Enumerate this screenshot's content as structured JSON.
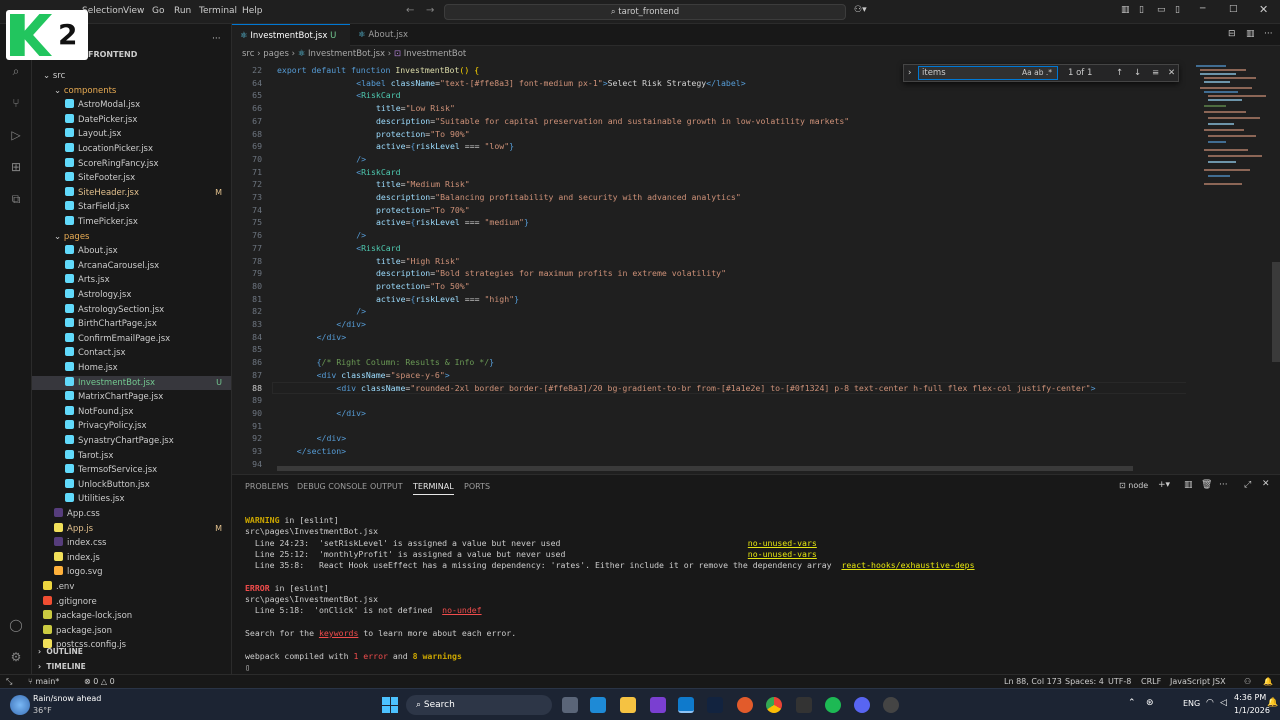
{
  "menu": [
    "Selection",
    "View",
    "Go",
    "Run",
    "Terminal",
    "Help"
  ],
  "logo_text": "2",
  "command_center": "tarot_frontend",
  "explorer": {
    "root": "FRONTEND",
    "rows": [
      {
        "label": "src",
        "indent": 1,
        "type": "folder"
      },
      {
        "label": "components",
        "indent": 2,
        "type": "folder",
        "color": "#e8ab53"
      },
      {
        "label": "AstroModal.jsx",
        "indent": 3,
        "type": "jsx"
      },
      {
        "label": "DatePicker.jsx",
        "indent": 3,
        "type": "jsx"
      },
      {
        "label": "Layout.jsx",
        "indent": 3,
        "type": "jsx"
      },
      {
        "label": "LocationPicker.jsx",
        "indent": 3,
        "type": "jsx"
      },
      {
        "label": "ScoreRingFancy.jsx",
        "indent": 3,
        "type": "jsx"
      },
      {
        "label": "SiteFooter.jsx",
        "indent": 3,
        "type": "jsx"
      },
      {
        "label": "SiteHeader.jsx",
        "indent": 3,
        "type": "jsx",
        "badge": "M",
        "color": "#e2c08d"
      },
      {
        "label": "StarField.jsx",
        "indent": 3,
        "type": "jsx"
      },
      {
        "label": "TimePicker.jsx",
        "indent": 3,
        "type": "jsx"
      },
      {
        "label": "pages",
        "indent": 2,
        "type": "folder",
        "color": "#e8ab53"
      },
      {
        "label": "About.jsx",
        "indent": 3,
        "type": "jsx"
      },
      {
        "label": "ArcanaCarousel.jsx",
        "indent": 3,
        "type": "jsx"
      },
      {
        "label": "Arts.jsx",
        "indent": 3,
        "type": "jsx"
      },
      {
        "label": "Astrology.jsx",
        "indent": 3,
        "type": "jsx"
      },
      {
        "label": "AstrologySection.jsx",
        "indent": 3,
        "type": "jsx"
      },
      {
        "label": "BirthChartPage.jsx",
        "indent": 3,
        "type": "jsx"
      },
      {
        "label": "ConfirmEmailPage.jsx",
        "indent": 3,
        "type": "jsx"
      },
      {
        "label": "Contact.jsx",
        "indent": 3,
        "type": "jsx"
      },
      {
        "label": "Home.jsx",
        "indent": 3,
        "type": "jsx"
      },
      {
        "label": "InvestmentBot.jsx",
        "indent": 3,
        "type": "jsx",
        "badge": "U",
        "color": "#73c991",
        "selected": true
      },
      {
        "label": "MatrixChartPage.jsx",
        "indent": 3,
        "type": "jsx"
      },
      {
        "label": "NotFound.jsx",
        "indent": 3,
        "type": "jsx"
      },
      {
        "label": "PrivacyPolicy.jsx",
        "indent": 3,
        "type": "jsx"
      },
      {
        "label": "SynastryChartPage.jsx",
        "indent": 3,
        "type": "jsx"
      },
      {
        "label": "Tarot.jsx",
        "indent": 3,
        "type": "jsx"
      },
      {
        "label": "TermsofService.jsx",
        "indent": 3,
        "type": "jsx"
      },
      {
        "label": "UnlockButton.jsx",
        "indent": 3,
        "type": "jsx"
      },
      {
        "label": "Utilities.jsx",
        "indent": 3,
        "type": "jsx"
      },
      {
        "label": "App.css",
        "indent": 2,
        "type": "css"
      },
      {
        "label": "App.js",
        "indent": 2,
        "type": "js",
        "badge": "M",
        "color": "#e2c08d"
      },
      {
        "label": "index.css",
        "indent": 2,
        "type": "css"
      },
      {
        "label": "index.js",
        "indent": 2,
        "type": "js"
      },
      {
        "label": "logo.svg",
        "indent": 2,
        "type": "svg"
      },
      {
        "label": ".env",
        "indent": 1,
        "type": "env"
      },
      {
        "label": ".gitignore",
        "indent": 1,
        "type": "git"
      },
      {
        "label": "package-lock.json",
        "indent": 1,
        "type": "json"
      },
      {
        "label": "package.json",
        "indent": 1,
        "type": "json"
      },
      {
        "label": "postcss.config.js",
        "indent": 1,
        "type": "js"
      }
    ],
    "outline": "OUTLINE",
    "timeline": "TIMELINE"
  },
  "tabs": [
    {
      "label": "InvestmentBot.jsx",
      "suffix": "U",
      "active": true
    },
    {
      "label": "About.jsx",
      "suffix": "",
      "active": false
    }
  ],
  "breadcrumb": [
    "src",
    "pages",
    "InvestmentBot.jsx",
    "InvestmentBot"
  ],
  "find": {
    "value": "items",
    "result": "1 of 1",
    "opts": "Aa ab .*"
  },
  "code": [
    {
      "n": "22",
      "t": "<span class='kw'>export default function</span> <span class='fn'>InvestmentBot</span><span class='br'>()</span> <span class='br'>{</span>",
      "indent": 0
    },
    {
      "n": "64",
      "t": "<span class='tg'>&lt;label</span> <span class='at'>className</span><span class='pl'>=</span><span class='st'>\"text-[#ffe8a3] font-medium px-1\"</span><span class='tg'>&gt;</span><span class='pl'>Select Risk Strategy</span><span class='tg'>&lt;/label&gt;</span>",
      "indent": 12
    },
    {
      "n": "65",
      "t": "<span class='tg'>&lt;</span><span class='cp'>RiskCard</span>",
      "indent": 12
    },
    {
      "n": "66",
      "t": "<span class='at'>title</span><span class='pl'>=</span><span class='st'>\"Low Risk\"</span>",
      "indent": 15
    },
    {
      "n": "67",
      "t": "<span class='at'>description</span><span class='pl'>=</span><span class='st'>\"Suitable for capital preservation and sustainable growth in low-volatility markets\"</span>",
      "indent": 15
    },
    {
      "n": "68",
      "t": "<span class='at'>protection</span><span class='pl'>=</span><span class='st'>\"To 90%\"</span>",
      "indent": 15
    },
    {
      "n": "69",
      "t": "<span class='at'>active</span><span class='pl'>=</span><span class='kw'>{</span><span class='at'>riskLevel</span> <span class='pl'>===</span> <span class='st'>\"low\"</span><span class='kw'>}</span>",
      "indent": 15
    },
    {
      "n": "70",
      "t": "<span class='tg'>/&gt;</span>",
      "indent": 12
    },
    {
      "n": "71",
      "t": "<span class='tg'>&lt;</span><span class='cp'>RiskCard</span>",
      "indent": 12
    },
    {
      "n": "72",
      "t": "<span class='at'>title</span><span class='pl'>=</span><span class='st'>\"Medium Risk\"</span>",
      "indent": 15
    },
    {
      "n": "73",
      "t": "<span class='at'>description</span><span class='pl'>=</span><span class='st'>\"Balancing profitability and security with advanced analytics\"</span>",
      "indent": 15
    },
    {
      "n": "74",
      "t": "<span class='at'>protection</span><span class='pl'>=</span><span class='st'>\"To 70%\"</span>",
      "indent": 15
    },
    {
      "n": "75",
      "t": "<span class='at'>active</span><span class='pl'>=</span><span class='kw'>{</span><span class='at'>riskLevel</span> <span class='pl'>===</span> <span class='st'>\"medium\"</span><span class='kw'>}</span>",
      "indent": 15
    },
    {
      "n": "76",
      "t": "<span class='tg'>/&gt;</span>",
      "indent": 12
    },
    {
      "n": "77",
      "t": "<span class='tg'>&lt;</span><span class='cp'>RiskCard</span>",
      "indent": 12
    },
    {
      "n": "78",
      "t": "<span class='at'>title</span><span class='pl'>=</span><span class='st'>\"High Risk\"</span>",
      "indent": 15
    },
    {
      "n": "79",
      "t": "<span class='at'>description</span><span class='pl'>=</span><span class='st'>\"Bold strategies for maximum profits in extreme volatility\"</span>",
      "indent": 15
    },
    {
      "n": "80",
      "t": "<span class='at'>protection</span><span class='pl'>=</span><span class='st'>\"To 50%\"</span>",
      "indent": 15
    },
    {
      "n": "81",
      "t": "<span class='at'>active</span><span class='pl'>=</span><span class='kw'>{</span><span class='at'>riskLevel</span> <span class='pl'>===</span> <span class='st'>\"high\"</span><span class='kw'>}</span>",
      "indent": 15
    },
    {
      "n": "82",
      "t": "<span class='tg'>/&gt;</span>",
      "indent": 12
    },
    {
      "n": "83",
      "t": "<span class='tg'>&lt;/div&gt;</span>",
      "indent": 9
    },
    {
      "n": "84",
      "t": "<span class='tg'>&lt;/div&gt;</span>",
      "indent": 6
    },
    {
      "n": "85",
      "t": "",
      "indent": 0
    },
    {
      "n": "86",
      "t": "<span class='kw'>{</span><span class='cm'>/* Right Column: Results &amp; Info */</span><span class='kw'>}</span>",
      "indent": 6
    },
    {
      "n": "87",
      "t": "<span class='tg'>&lt;div</span> <span class='at'>className</span><span class='pl'>=</span><span class='st'>\"space-y-6\"</span><span class='tg'>&gt;</span>",
      "indent": 6
    },
    {
      "n": "88",
      "t": "<span class='tg'>&lt;div</span> <span class='at'>className</span><span class='pl'>=</span><span class='st'>\"rounded-2xl border border-[#ffe8a3]/20 bg-gradient-to-br from-[#1a1e2e] to-[#0f1324] p-8 text-center h-full flex flex-col justify-center\"</span><span class='tg'>&gt;</span>",
      "indent": 9,
      "cur": true
    },
    {
      "n": "89",
      "t": "",
      "indent": 0
    },
    {
      "n": "90",
      "t": "<span class='tg'>&lt;/div&gt;</span>",
      "indent": 9
    },
    {
      "n": "91",
      "t": "",
      "indent": 0
    },
    {
      "n": "92",
      "t": "<span class='tg'>&lt;/div&gt;</span>",
      "indent": 6
    },
    {
      "n": "93",
      "t": "<span class='tg'>&lt;/section&gt;</span>",
      "indent": 3
    },
    {
      "n": "94",
      "t": "",
      "indent": 0
    }
  ],
  "panel": {
    "tabs": [
      "PROBLEMS",
      "DEBUG CONSOLE",
      "OUTPUT",
      "TERMINAL",
      "PORTS"
    ],
    "active_tab": "TERMINAL",
    "shell": "node",
    "lines": [
      "<span class='warn'>WARNING</span> in [eslint]",
      "src\\pages\\InvestmentBot.jsx",
      "  Line 24:23:  'setRiskLevel' is assigned a value but never used                                      <span class='link'>no-unused-vars</span>",
      "  Line 25:12:  'monthlyProfit' is assigned a value but never used                                     <span class='link'>no-unused-vars</span>",
      "  Line 35:8:   React Hook useEffect has a missing dependency: 'rates'. Either include it or remove the dependency array  <span class='link'>react-hooks/exhaustive-deps</span>",
      "",
      "<span class='err'>ERROR</span> in [eslint]",
      "src\\pages\\InvestmentBot.jsx",
      "  Line 5:18:  'onClick' is not defined  <span class='redl'>no-undef</span>",
      "",
      "Search for the <span class='redl'>keywords</span> to learn more about each error.",
      "",
      "webpack compiled with <span class='err' style='font-weight:normal'>1 error</span> and <span class='warn'>8 warnings</span>",
      "▯"
    ]
  },
  "status": {
    "branch": "main*",
    "problems": "0 △ 0",
    "position": "Ln 88, Col 173",
    "spaces": "Spaces: 4",
    "encoding": "UTF-8",
    "eol": "CRLF",
    "language": "JavaScript JSX"
  },
  "taskbar": {
    "weather_title": "Rain/snow ahead",
    "weather_temp": "36°F",
    "search": "Search",
    "lang": "ENG",
    "time": "4:36 PM",
    "date": "1/1/2026"
  }
}
